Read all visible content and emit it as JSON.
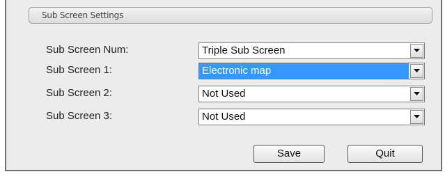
{
  "section": {
    "title": "Sub Screen Settings"
  },
  "fields": [
    {
      "label": "Sub Screen Num:",
      "value": "Triple Sub Screen",
      "selected": false
    },
    {
      "label": "Sub Screen 1:",
      "value": "Electronic map",
      "selected": true
    },
    {
      "label": "Sub Screen 2:",
      "value": "Not Used",
      "selected": false
    },
    {
      "label": "Sub Screen 3:",
      "value": "Not Used",
      "selected": false
    }
  ],
  "buttons": {
    "save": "Save",
    "quit": "Quit"
  },
  "icons": {
    "dropdown": "chevron-down-icon"
  },
  "colors": {
    "selection": "#3399ff",
    "panel": "#ececec"
  }
}
